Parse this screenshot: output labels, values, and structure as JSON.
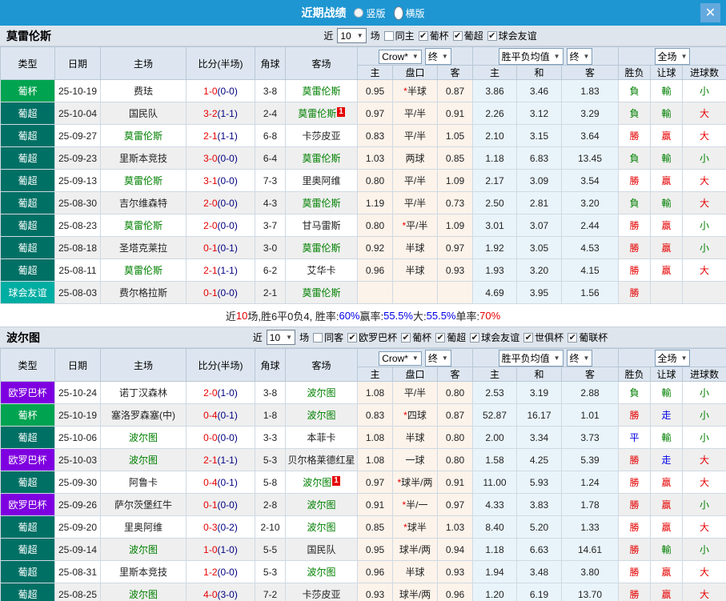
{
  "titlebar": {
    "title": "近期战绩",
    "radios": [
      {
        "label": "竖版",
        "selected": false
      },
      {
        "label": "横版",
        "selected": true
      }
    ],
    "close": "✕"
  },
  "icons": {
    "dropdown_arrow": "▼",
    "checkbox_check": "✔",
    "close": "✕"
  },
  "table": {
    "columns": [
      "类型",
      "日期",
      "主场",
      "比分(半场)",
      "角球",
      "客场"
    ],
    "subcolumns": [
      "主",
      "盘口",
      "客",
      "主",
      "和",
      "客",
      "胜负",
      "让球",
      "进球数"
    ],
    "dropdowns": {
      "book": "Crow*",
      "final1": "终",
      "avg": "胜平负均值",
      "final2": "终",
      "scope": "全场"
    }
  },
  "colors": {
    "topbar": "#1e96d2",
    "type": {
      "葡杯": "#00a350",
      "葡超": "#007065",
      "球会友谊": "#00ada2",
      "欧罗巴杯": "#7e00e0"
    },
    "result": {
      "勝": "#e60000",
      "負": "#008000",
      "平": "#0000e6",
      "贏": "#e60000",
      "輸": "#008000",
      "走": "#0000e6",
      "大": "#e60000",
      "小": "#008000"
    },
    "accent_red": "#e60000",
    "accent_blue": "#0000e6",
    "accent_green": "#008000"
  },
  "sections": [
    {
      "team": "莫雷伦斯",
      "near_label": "近",
      "count": "10",
      "matches_label": "场",
      "filters": [
        {
          "label": "同主",
          "checked": false
        },
        {
          "label": "葡杯",
          "checked": true
        },
        {
          "label": "葡超",
          "checked": true
        },
        {
          "label": "球会友谊",
          "checked": true
        }
      ],
      "rows": [
        {
          "type": "葡杯",
          "date": "25-10-19",
          "home": "费珐",
          "score": "1-0",
          "half": "(0-0)",
          "corners": "3-8",
          "away": "莫雷伦斯",
          "odds": [
            "0.95",
            "*半球",
            "0.87"
          ],
          "avg": [
            "3.86",
            "3.46",
            "1.83"
          ],
          "res": [
            "負",
            "輸",
            "小"
          ]
        },
        {
          "type": "葡超",
          "date": "25-10-04",
          "home": "国民队",
          "score": "3-2",
          "half": "(1-1)",
          "corners": "2-4",
          "away": "莫雷伦斯",
          "awayBadge": "1",
          "odds": [
            "0.97",
            "平/半",
            "0.91"
          ],
          "avg": [
            "2.26",
            "3.12",
            "3.29"
          ],
          "res": [
            "負",
            "輸",
            "大"
          ]
        },
        {
          "type": "葡超",
          "date": "25-09-27",
          "home": "莫雷伦斯",
          "score": "2-1",
          "half": "(1-1)",
          "corners": "6-8",
          "away": "卡莎皮亚",
          "odds": [
            "0.83",
            "平/半",
            "1.05"
          ],
          "avg": [
            "2.10",
            "3.15",
            "3.64"
          ],
          "res": [
            "勝",
            "贏",
            "大"
          ]
        },
        {
          "type": "葡超",
          "date": "25-09-23",
          "home": "里斯本竞技",
          "score": "3-0",
          "half": "(0-0)",
          "corners": "6-4",
          "away": "莫雷伦斯",
          "odds": [
            "1.03",
            "两球",
            "0.85"
          ],
          "avg": [
            "1.18",
            "6.83",
            "13.45"
          ],
          "res": [
            "負",
            "輸",
            "小"
          ]
        },
        {
          "type": "葡超",
          "date": "25-09-13",
          "home": "莫雷伦斯",
          "score": "3-1",
          "half": "(0-0)",
          "corners": "7-3",
          "away": "里奥阿维",
          "odds": [
            "0.80",
            "平/半",
            "1.09"
          ],
          "avg": [
            "2.17",
            "3.09",
            "3.54"
          ],
          "res": [
            "勝",
            "贏",
            "大"
          ]
        },
        {
          "type": "葡超",
          "date": "25-08-30",
          "home": "吉尔维森特",
          "score": "2-0",
          "half": "(0-0)",
          "corners": "4-3",
          "away": "莫雷伦斯",
          "odds": [
            "1.19",
            "平/半",
            "0.73"
          ],
          "avg": [
            "2.50",
            "2.81",
            "3.20"
          ],
          "res": [
            "負",
            "輸",
            "大"
          ]
        },
        {
          "type": "葡超",
          "date": "25-08-23",
          "home": "莫雷伦斯",
          "score": "2-0",
          "half": "(0-0)",
          "corners": "3-7",
          "away": "甘马雷斯",
          "odds": [
            "0.80",
            "*平/半",
            "1.09"
          ],
          "avg": [
            "3.01",
            "3.07",
            "2.44"
          ],
          "res": [
            "勝",
            "贏",
            "小"
          ]
        },
        {
          "type": "葡超",
          "date": "25-08-18",
          "home": "圣塔克莱拉",
          "score": "0-1",
          "half": "(0-1)",
          "corners": "3-0",
          "away": "莫雷伦斯",
          "odds": [
            "0.92",
            "半球",
            "0.97"
          ],
          "avg": [
            "1.92",
            "3.05",
            "4.53"
          ],
          "res": [
            "勝",
            "贏",
            "小"
          ]
        },
        {
          "type": "葡超",
          "date": "25-08-11",
          "home": "莫雷伦斯",
          "score": "2-1",
          "half": "(1-1)",
          "corners": "6-2",
          "away": "艾华卡",
          "odds": [
            "0.96",
            "半球",
            "0.93"
          ],
          "avg": [
            "1.93",
            "3.20",
            "4.15"
          ],
          "res": [
            "勝",
            "贏",
            "大"
          ]
        },
        {
          "type": "球会友谊",
          "date": "25-08-03",
          "home": "费尔格拉斯",
          "score": "0-1",
          "half": "(0-0)",
          "corners": "2-1",
          "away": "莫雷伦斯",
          "odds": [
            "",
            "",
            ""
          ],
          "avg": [
            "4.69",
            "3.95",
            "1.56"
          ],
          "res": [
            "勝",
            "",
            ""
          ]
        }
      ],
      "summary": [
        {
          "t": "近"
        },
        {
          "t": "10",
          "c": "#e60000"
        },
        {
          "t": "场,胜6平0负4, 胜率:"
        },
        {
          "t": "60%",
          "c": "#0000e6"
        },
        {
          "t": " 赢率:"
        },
        {
          "t": "55.5%",
          "c": "#0000e6"
        },
        {
          "t": " 大:"
        },
        {
          "t": "55.5%",
          "c": "#0000e6"
        },
        {
          "t": " 单率:"
        },
        {
          "t": "70%",
          "c": "#e60000"
        }
      ]
    },
    {
      "team": "波尔图",
      "near_label": "近",
      "count": "10",
      "matches_label": "场",
      "filters": [
        {
          "label": "同客",
          "checked": false
        },
        {
          "label": "欧罗巴杯",
          "checked": true
        },
        {
          "label": "葡杯",
          "checked": true
        },
        {
          "label": "葡超",
          "checked": true
        },
        {
          "label": "球会友谊",
          "checked": true
        },
        {
          "label": "世俱杯",
          "checked": true
        },
        {
          "label": "葡联杯",
          "checked": true
        }
      ],
      "rows": [
        {
          "type": "欧罗巴杯",
          "date": "25-10-24",
          "home": "诺丁汉森林",
          "score": "2-0",
          "half": "(1-0)",
          "corners": "3-8",
          "away": "波尔图",
          "odds": [
            "1.08",
            "平/半",
            "0.80"
          ],
          "avg": [
            "2.53",
            "3.19",
            "2.88"
          ],
          "res": [
            "負",
            "輸",
            "小"
          ]
        },
        {
          "type": "葡杯",
          "date": "25-10-19",
          "home": "塞洛罗森塞(中)",
          "score": "0-4",
          "half": "(0-1)",
          "corners": "1-8",
          "away": "波尔图",
          "odds": [
            "0.83",
            "*四球",
            "0.87"
          ],
          "avg": [
            "52.87",
            "16.17",
            "1.01"
          ],
          "res": [
            "勝",
            "走",
            "小"
          ]
        },
        {
          "type": "葡超",
          "date": "25-10-06",
          "home": "波尔图",
          "score": "0-0",
          "half": "(0-0)",
          "corners": "3-3",
          "away": "本菲卡",
          "odds": [
            "1.08",
            "半球",
            "0.80"
          ],
          "avg": [
            "2.00",
            "3.34",
            "3.73"
          ],
          "res": [
            "平",
            "輸",
            "小"
          ]
        },
        {
          "type": "欧罗巴杯",
          "date": "25-10-03",
          "home": "波尔图",
          "score": "2-1",
          "half": "(1-1)",
          "corners": "5-3",
          "away": "贝尔格莱德红星",
          "odds": [
            "1.08",
            "一球",
            "0.80"
          ],
          "avg": [
            "1.58",
            "4.25",
            "5.39"
          ],
          "res": [
            "勝",
            "走",
            "大"
          ]
        },
        {
          "type": "葡超",
          "date": "25-09-30",
          "home": "阿鲁卡",
          "score": "0-4",
          "half": "(0-1)",
          "corners": "5-8",
          "away": "波尔图",
          "awayBadge": "1",
          "odds": [
            "0.97",
            "*球半/两",
            "0.91"
          ],
          "avg": [
            "11.00",
            "5.93",
            "1.24"
          ],
          "res": [
            "勝",
            "贏",
            "大"
          ]
        },
        {
          "type": "欧罗巴杯",
          "date": "25-09-26",
          "home": "萨尔茨堡红牛",
          "score": "0-1",
          "half": "(0-0)",
          "corners": "2-8",
          "away": "波尔图",
          "odds": [
            "0.91",
            "*半/一",
            "0.97"
          ],
          "avg": [
            "4.33",
            "3.83",
            "1.78"
          ],
          "res": [
            "勝",
            "贏",
            "小"
          ]
        },
        {
          "type": "葡超",
          "date": "25-09-20",
          "home": "里奥阿维",
          "score": "0-3",
          "half": "(0-2)",
          "corners": "2-10",
          "away": "波尔图",
          "odds": [
            "0.85",
            "*球半",
            "1.03"
          ],
          "avg": [
            "8.40",
            "5.20",
            "1.33"
          ],
          "res": [
            "勝",
            "贏",
            "大"
          ]
        },
        {
          "type": "葡超",
          "date": "25-09-14",
          "home": "波尔图",
          "score": "1-0",
          "half": "(1-0)",
          "corners": "5-5",
          "away": "国民队",
          "odds": [
            "0.95",
            "球半/两",
            "0.94"
          ],
          "avg": [
            "1.18",
            "6.63",
            "14.61"
          ],
          "res": [
            "勝",
            "輸",
            "小"
          ]
        },
        {
          "type": "葡超",
          "date": "25-08-31",
          "home": "里斯本竞技",
          "score": "1-2",
          "half": "(0-0)",
          "corners": "5-3",
          "away": "波尔图",
          "odds": [
            "0.96",
            "半球",
            "0.93"
          ],
          "avg": [
            "1.94",
            "3.48",
            "3.80"
          ],
          "res": [
            "勝",
            "贏",
            "大"
          ]
        },
        {
          "type": "葡超",
          "date": "25-08-25",
          "home": "波尔图",
          "score": "4-0",
          "half": "(3-0)",
          "corners": "7-2",
          "away": "卡莎皮亚",
          "odds": [
            "0.93",
            "球半/两",
            "0.96"
          ],
          "avg": [
            "1.20",
            "6.19",
            "13.70"
          ],
          "res": [
            "勝",
            "贏",
            "大"
          ]
        }
      ]
    }
  ]
}
